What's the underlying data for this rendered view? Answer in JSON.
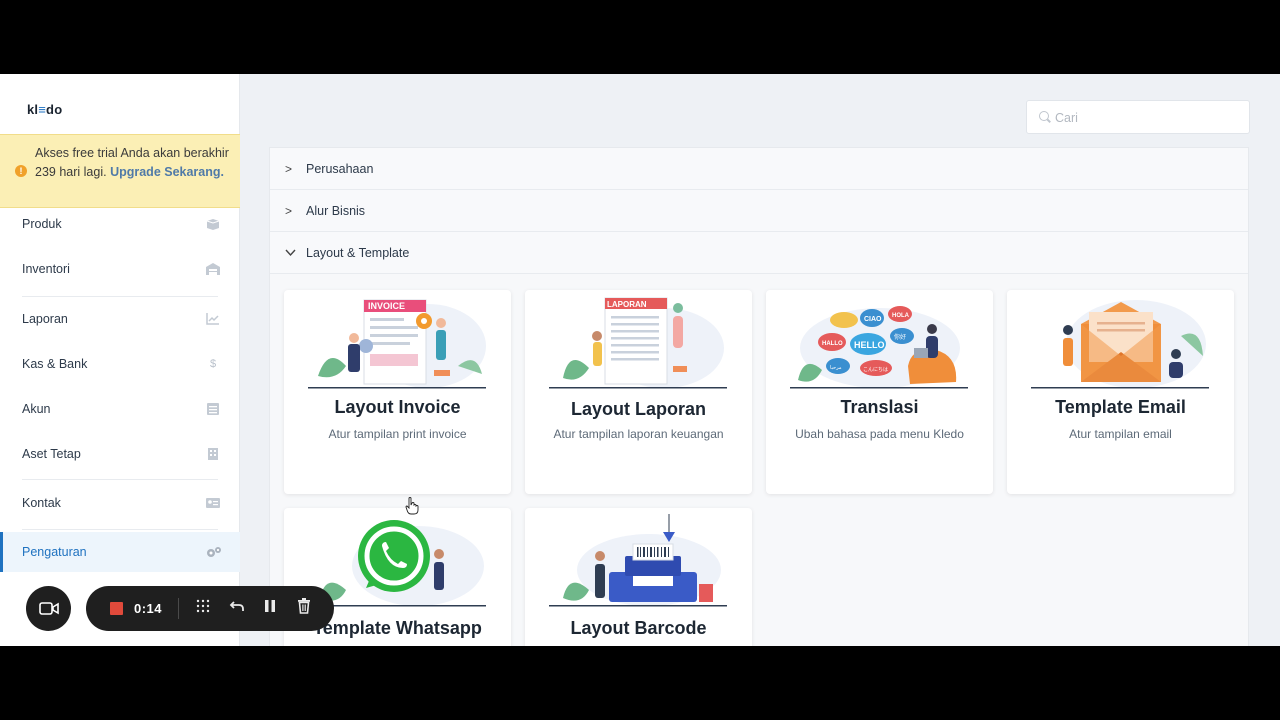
{
  "app": {
    "logo_left": "kl",
    "logo_accent": "≡",
    "logo_right": "do"
  },
  "trial": {
    "text": "Akses free trial Anda akan berakhir 239 hari lagi.",
    "link": "Upgrade Sekarang."
  },
  "sidebar": {
    "items": [
      {
        "label": "Produk",
        "icon": "box-icon"
      },
      {
        "label": "Inventori",
        "icon": "warehouse-icon"
      },
      {
        "label": "Laporan",
        "icon": "chart-icon"
      },
      {
        "label": "Kas & Bank",
        "icon": "dollar-icon"
      },
      {
        "label": "Akun",
        "icon": "list-icon"
      },
      {
        "label": "Aset Tetap",
        "icon": "building-icon"
      },
      {
        "label": "Kontak",
        "icon": "contact-card-icon"
      },
      {
        "label": "Pengaturan",
        "icon": "gears-icon"
      }
    ],
    "active": "Pengaturan"
  },
  "search": {
    "placeholder": "Cari"
  },
  "accordion": {
    "sections": [
      {
        "label": "Perusahaan",
        "expanded": false
      },
      {
        "label": "Alur Bisnis",
        "expanded": false
      },
      {
        "label": "Layout & Template",
        "expanded": true
      }
    ]
  },
  "cards": [
    {
      "title": "Layout Invoice",
      "desc": "Atur tampilan print invoice",
      "illustration": "invoice-illustration",
      "banner": "INVOICE"
    },
    {
      "title": "Layout Laporan",
      "desc": "Atur tampilan laporan keuangan",
      "illustration": "report-illustration",
      "banner": "LAPORAN"
    },
    {
      "title": "Translasi",
      "desc": "Ubah bahasa pada menu Kledo",
      "illustration": "speech-bubbles-illustration",
      "bubbles": [
        "CIAO",
        "HOLA",
        "HALLO",
        "HELLO",
        "你好",
        "مرحبا",
        "こんにちは"
      ]
    },
    {
      "title": "Template Email",
      "desc": "Atur tampilan email",
      "illustration": "envelope-illustration"
    },
    {
      "title": "Template Whatsapp",
      "desc": "",
      "illustration": "whatsapp-illustration"
    },
    {
      "title": "Layout Barcode",
      "desc": "",
      "illustration": "barcode-printer-illustration"
    }
  ],
  "recorder": {
    "time": "0:14"
  },
  "colors": {
    "accent": "#1f72c0",
    "trial_bg": "#fbefb5",
    "record_red": "#e04a3b"
  }
}
